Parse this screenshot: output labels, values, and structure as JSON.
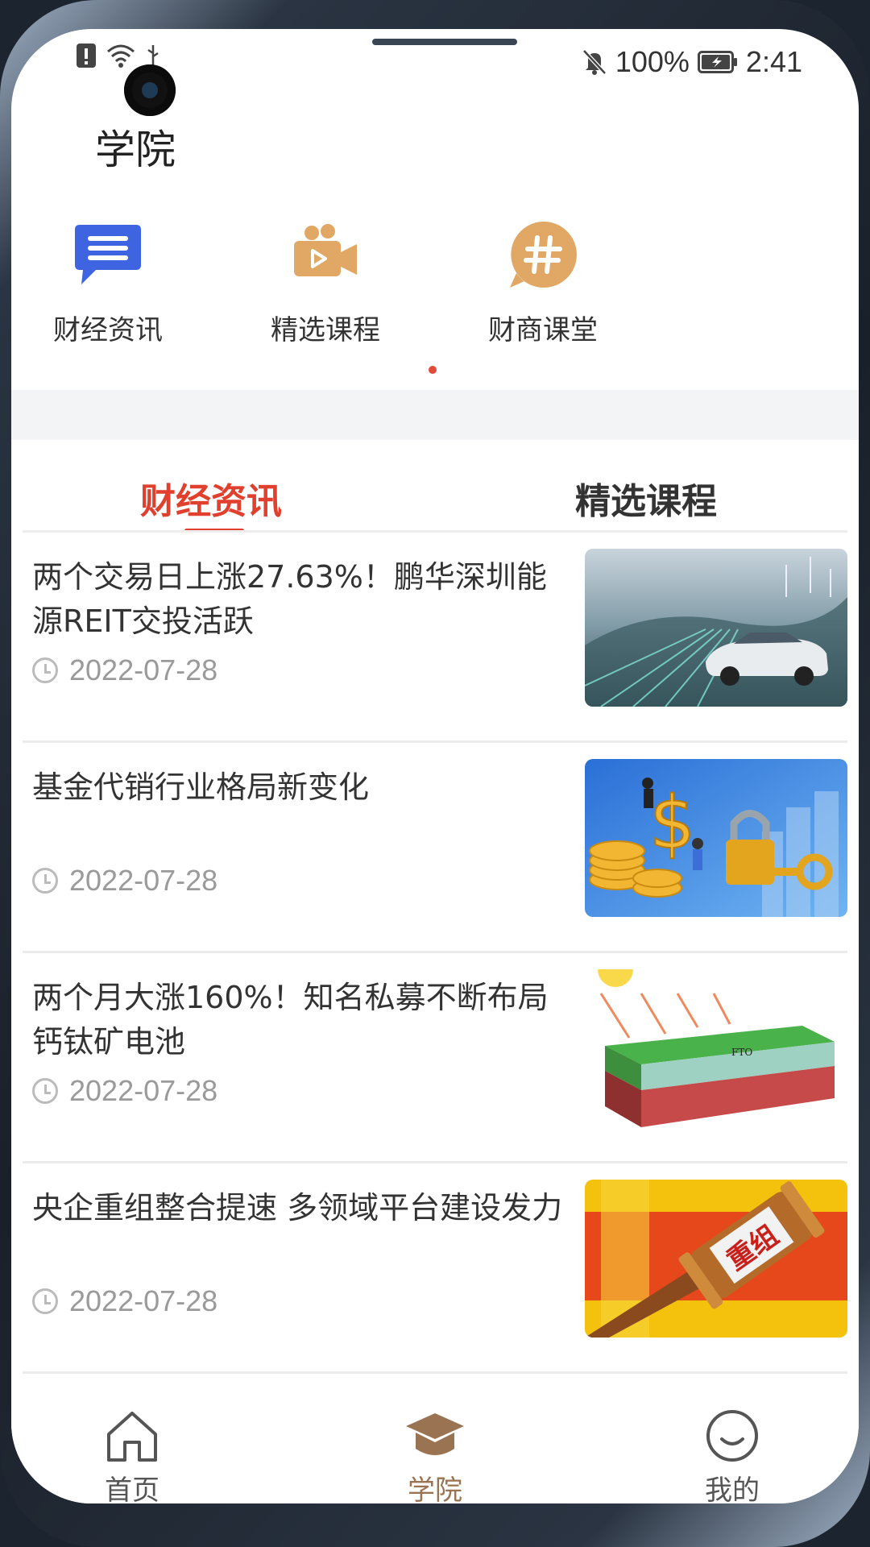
{
  "status_bar": {
    "battery_text": "100%",
    "time": "2:41"
  },
  "page": {
    "title": "学院"
  },
  "quick_nav": [
    {
      "label": "财经资讯",
      "icon": "message-icon",
      "color": "#3f64e2"
    },
    {
      "label": "精选课程",
      "icon": "video-camera-icon",
      "color": "#e0a864"
    },
    {
      "label": "财商课堂",
      "icon": "hashtag-icon",
      "color": "#e0a864"
    }
  ],
  "tabs": [
    {
      "label": "财经资讯",
      "active": true
    },
    {
      "label": "精选课程",
      "active": false
    }
  ],
  "news": [
    {
      "title": "两个交易日上涨27.63%！鹏华深圳能源REIT交投活跃",
      "date": "2022-07-28",
      "image": "electric-car-road"
    },
    {
      "title": "基金代销行业格局新变化",
      "date": "2022-07-28",
      "image": "coins-lock-key"
    },
    {
      "title": "两个月大涨160%！知名私募不断布局钙钛矿电池",
      "date": "2022-07-28",
      "image": "perovskite-cell-diagram"
    },
    {
      "title": "央企重组整合提速 多领域平台建设发力",
      "date": "2022-07-28",
      "image": "gavel-restructuring"
    }
  ],
  "news_image_text": {
    "fto": "FTO",
    "gavel": "重组"
  },
  "tab_bar": [
    {
      "label": "首页",
      "icon": "home-icon",
      "active": false
    },
    {
      "label": "学院",
      "icon": "graduation-cap-icon",
      "active": true
    },
    {
      "label": "我的",
      "icon": "smile-icon",
      "active": false
    }
  ],
  "colors": {
    "accent_red": "#e2402e",
    "tab_active_brown": "#9a7452",
    "tab_inactive": "#555555"
  }
}
